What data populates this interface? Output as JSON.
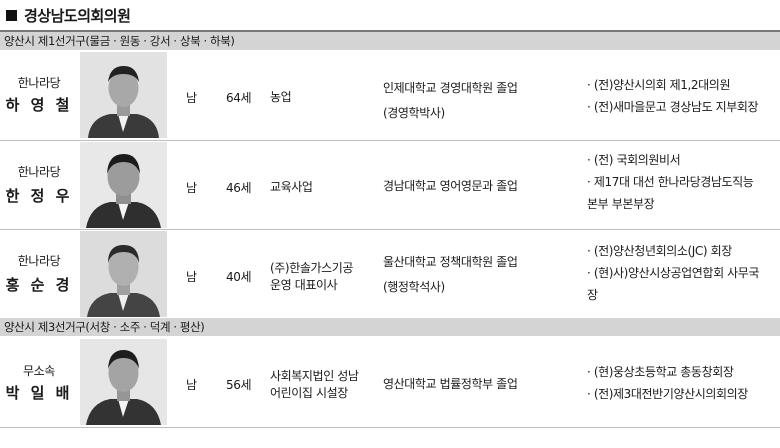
{
  "title": "경상남도의회의원",
  "districts": [
    {
      "label": "양산시 제1선거구(물금 · 원동 · 강서 · 상북 · 하북)"
    },
    {
      "label": "양산시 제3선거구(서창 · 소주 · 덕계 · 평산)"
    }
  ],
  "candidates": [
    {
      "party": "한나라당",
      "name": "하 영 철",
      "gender": "남",
      "age": "64세",
      "job": [
        "농업"
      ],
      "edu": [
        "인제대학교 경영대학원 졸업",
        "(경영학박사)"
      ],
      "career": [
        "· (전)양산시의회 제1,2대의원",
        "· (전)새마을문고 경상남도 지부회장"
      ]
    },
    {
      "party": "한나라당",
      "name": "한 정 우",
      "gender": "남",
      "age": "46세",
      "job": [
        "교육사업"
      ],
      "edu": [
        "경남대학교 영어영문과 졸업"
      ],
      "career": [
        "· (전) 국회의원비서",
        "· 제17대 대선 한나라당경남도직능",
        "  본부 부본부장"
      ]
    },
    {
      "party": "한나라당",
      "name": "홍 순 경",
      "gender": "남",
      "age": "40세",
      "job": [
        "(주)한솔가스기공",
        "운영 대표이사"
      ],
      "edu": [
        "울산대학교 정책대학원 졸업",
        "(행정학석사)"
      ],
      "career": [
        "· (전)양산청년회의소(JC) 회장",
        "· (현)사)양산시상공업연합회 사무국",
        "  장"
      ]
    },
    {
      "party": "무소속",
      "name": "박 일 배",
      "gender": "남",
      "age": "56세",
      "job": [
        "사회복지법인 성남",
        "어린이집 시설장"
      ],
      "edu": [
        "영산대학교 법률정학부 졸업"
      ],
      "career": [
        "· (현)웅상초등학교 총동창회장",
        "· (전)제3대전반기양산시의회의장"
      ]
    }
  ]
}
